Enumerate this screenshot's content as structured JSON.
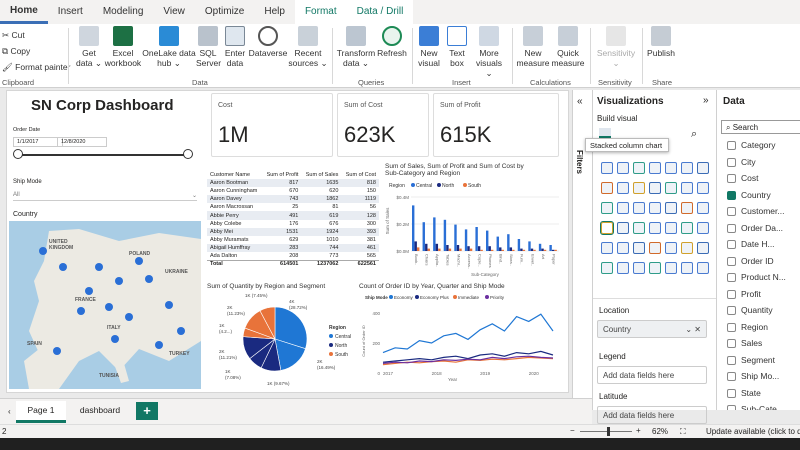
{
  "tabs": [
    "Home",
    "Insert",
    "Modeling",
    "View",
    "Optimize",
    "Help",
    "Format",
    "Data / Drill"
  ],
  "ribbon": {
    "clipboard": {
      "cut": "Cut",
      "copy": "Copy",
      "format_painter": "Format painter",
      "label": "Clipboard"
    },
    "data_items": [
      "Get\ndata ⌄",
      "Excel\nworkbook",
      "OneLake data\nhub ⌄",
      "SQL\nServer",
      "Enter\ndata",
      "Dataverse",
      "Recent\nsources ⌄"
    ],
    "data_label": "Data",
    "query_items": [
      "Transform\ndata ⌄",
      "Refresh"
    ],
    "queries_label": "Queries",
    "insert_items": [
      "New\nvisual",
      "Text\nbox",
      "More\nvisuals ⌄"
    ],
    "insert_label": "Insert",
    "calc_items": [
      "New\nmeasure",
      "Quick\nmeasure"
    ],
    "calc_label": "Calculations",
    "sensitivity": "Sensitivity\n⌄",
    "sensitivity_label": "Sensitivity",
    "publish": "Publish",
    "share_label": "Share"
  },
  "dashboard": {
    "title": "SN Corp Dashboard",
    "order_date_label": "Order Date",
    "date_from": "1/1/2017",
    "date_to": "12/8/2020",
    "ship_mode_label": "Ship Mode",
    "ship_mode_value": "All",
    "country_label": "Country",
    "map_labels": [
      "UNITED\nKINGDOM",
      "POLAND",
      "FRANCE",
      "SPAIN",
      "UKRAINE",
      "TURKEY",
      "ITALY",
      "TUNISIA"
    ],
    "cards": [
      {
        "label": "Cost",
        "value": "1M"
      },
      {
        "label": "Sum of Cost",
        "value": "623K"
      },
      {
        "label": "Sum of Profit",
        "value": "615K"
      }
    ]
  },
  "table": {
    "headers": [
      "Customer Name",
      "Sum of Profit",
      "Sum of Sales",
      "Sum of Cost"
    ],
    "rows": [
      [
        "Aaron Bootman",
        "817",
        "1635",
        "818"
      ],
      [
        "Aaron Cunningham",
        "670",
        "620",
        "150"
      ],
      [
        "Aaron Davey",
        "743",
        "1862",
        "1119"
      ],
      [
        "Aaron Macrossan",
        "25",
        "81",
        "56"
      ],
      [
        "Abbie Perry",
        "491",
        "619",
        "128"
      ],
      [
        "Abby Colebe",
        "176",
        "676",
        "300"
      ],
      [
        "Abby Mei",
        "1531",
        "1924",
        "393"
      ],
      [
        "Abby Muramats",
        "629",
        "1010",
        "381"
      ],
      [
        "Abigail Humffray",
        "283",
        "744",
        "461"
      ],
      [
        "Ada Dalton",
        "208",
        "773",
        "565"
      ]
    ],
    "total": [
      "Total",
      "614501",
      "1237062",
      "622561"
    ]
  },
  "bar_chart_title": "Sum of Sales, Sum of Profit and Sum of Cost by\nSub-Category and Region",
  "pie_chart_title": "Sum of Quantity by Region and Segment",
  "line_chart_title": "Count of Order ID by Year, Quarter and Ship Mode",
  "chart_data": [
    {
      "type": "bar",
      "title": "Sum of Sales, Sum of Profit and Sum of Cost by Sub-Category and Region",
      "legend_title": "Region",
      "legend": [
        "Central",
        "North",
        "South"
      ],
      "xlabel": "Sub-Category",
      "ylabel": "Sum of Sales",
      "yticks": [
        "$0.4M",
        "$0.2M",
        "$0.0M"
      ],
      "categories": [
        "Book..",
        "Chairs",
        "Applia..",
        "Tables",
        "Machi..",
        "Access..",
        "Copie..",
        "Phones",
        "Bind..",
        "Stora..",
        "Furn..",
        "Envel..",
        "Art",
        "Paper"
      ],
      "series": [
        {
          "name": "Central",
          "values": [
            0.38,
            0.24,
            0.28,
            0.26,
            0.22,
            0.18,
            0.2,
            0.17,
            0.12,
            0.14,
            0.1,
            0.08,
            0.06,
            0.05
          ]
        },
        {
          "name": "North",
          "values": [
            0.08,
            0.06,
            0.06,
            0.05,
            0.05,
            0.04,
            0.04,
            0.04,
            0.03,
            0.03,
            0.02,
            0.02,
            0.02,
            0.01
          ]
        },
        {
          "name": "South",
          "values": [
            0.03,
            0.02,
            0.02,
            0.02,
            0.02,
            0.02,
            0.01,
            0.01,
            0.01,
            0.01,
            0.01,
            0.01,
            0.01,
            0.01
          ]
        }
      ],
      "ylim": [
        0,
        0.45
      ],
      "legend_position": "top-left"
    },
    {
      "type": "pie",
      "title": "Sum of Quantity by Region and Segment",
      "legend_title": "Region",
      "legend": [
        "Central",
        "North",
        "South"
      ],
      "slices": [
        {
          "label": "4K\n(28.72%)",
          "value": 28.72
        },
        {
          "label": "2K\n(16.49%)",
          "value": 16.49
        },
        {
          "label": "1K (9.67%)",
          "value": 9.67
        },
        {
          "label": "1K\n(7.08%)",
          "value": 7.08
        },
        {
          "label": "2K\n(11.21%)",
          "value": 11.21
        },
        {
          "label": "1K\n(4.2...)",
          "value": 4.2
        },
        {
          "label": "2K\n(11.23%)",
          "value": 11.23
        },
        {
          "label": "1K (7.45%)",
          "value": 7.45
        }
      ],
      "colors": [
        "#1f77d4",
        "#1f77d4",
        "#1a2a80",
        "#1a2a80",
        "#1a2a80",
        "#e8733a",
        "#e8733a",
        "#e8733a"
      ]
    },
    {
      "type": "line",
      "title": "Count of Order ID by Year, Quarter and Ship Mode",
      "legend_title": "Ship Mode",
      "legend": [
        "Economy",
        "Economy Plus",
        "Immediate",
        "Priority"
      ],
      "xlabel": "Year",
      "ylabel": "Count of Order ID",
      "x": [
        "2017",
        "2018",
        "2019",
        "2020"
      ],
      "yticks": [
        "400",
        "200",
        "0"
      ],
      "ylim": [
        0,
        500
      ],
      "series": [
        {
          "name": "Economy",
          "values": [
            120,
            160,
            150,
            220,
            200,
            260,
            280,
            230,
            310,
            360,
            300,
            420,
            380,
            440,
            300
          ]
        },
        {
          "name": "Economy Plus",
          "values": [
            40,
            50,
            60,
            70,
            60,
            80,
            90,
            70,
            100,
            110,
            90,
            120,
            110,
            130,
            100
          ]
        },
        {
          "name": "Immediate",
          "values": [
            20,
            30,
            40,
            35,
            45,
            50,
            40,
            60,
            55,
            65,
            60,
            70,
            80,
            75,
            70
          ]
        },
        {
          "name": "Priority",
          "values": [
            30,
            40,
            35,
            50,
            45,
            60,
            55,
            65,
            60,
            80,
            70,
            85,
            90,
            80,
            75
          ]
        }
      ],
      "colors": [
        "#1f77d4",
        "#1a2a80",
        "#e8733a",
        "#6b2fa0"
      ],
      "legend_position": "top-left"
    }
  ],
  "filters_label": "Filters",
  "viz": {
    "title": "Visualizations",
    "build": "Build visual",
    "tooltip": "Stacked column chart",
    "location_label": "Location",
    "location_value": "Country",
    "legend_label": "Legend",
    "legend_placeholder": "Add data fields here",
    "latitude_label": "Latitude",
    "latitude_placeholder": "Add data fields here"
  },
  "data_panel": {
    "title": "Data",
    "search": "Search",
    "items": [
      "Category",
      "City",
      "Cost",
      "Country",
      "Customer...",
      "Order Da...",
      "Date H...",
      "Order ID",
      "Product N...",
      "Profit",
      "Quantity",
      "Region",
      "Sales",
      "Segment",
      "Ship Mo...",
      "State",
      "Sub-Cate..."
    ]
  },
  "pages": [
    "Page 1",
    "dashboard"
  ],
  "status": {
    "page": "2",
    "zoom": "62%",
    "update": "Update available (click to d..."
  }
}
